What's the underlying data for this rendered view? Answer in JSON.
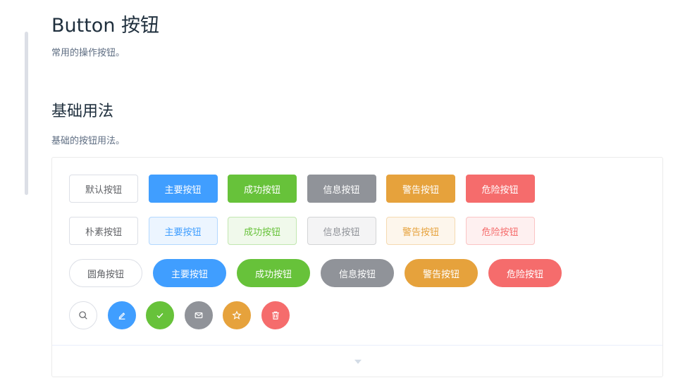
{
  "page": {
    "title": "Button 按钮",
    "description": "常用的操作按钮。"
  },
  "section": {
    "title": "基础用法",
    "description": "基础的按钮用法。"
  },
  "rows": {
    "normal": [
      "默认按钮",
      "主要按钮",
      "成功按钮",
      "信息按钮",
      "警告按钮",
      "危险按钮"
    ],
    "plain": [
      "朴素按钮",
      "主要按钮",
      "成功按钮",
      "信息按钮",
      "警告按钮",
      "危险按钮"
    ],
    "round": [
      "圆角按钮",
      "主要按钮",
      "成功按钮",
      "信息按钮",
      "警告按钮",
      "危险按钮"
    ],
    "circle_icons": [
      "search-icon",
      "edit-icon",
      "check-icon",
      "message-icon",
      "star-icon",
      "delete-icon"
    ]
  },
  "colors": {
    "primary": "#409eff",
    "success": "#67c23a",
    "info": "#909399",
    "warning": "#e6a23c",
    "danger": "#f56c6c"
  }
}
